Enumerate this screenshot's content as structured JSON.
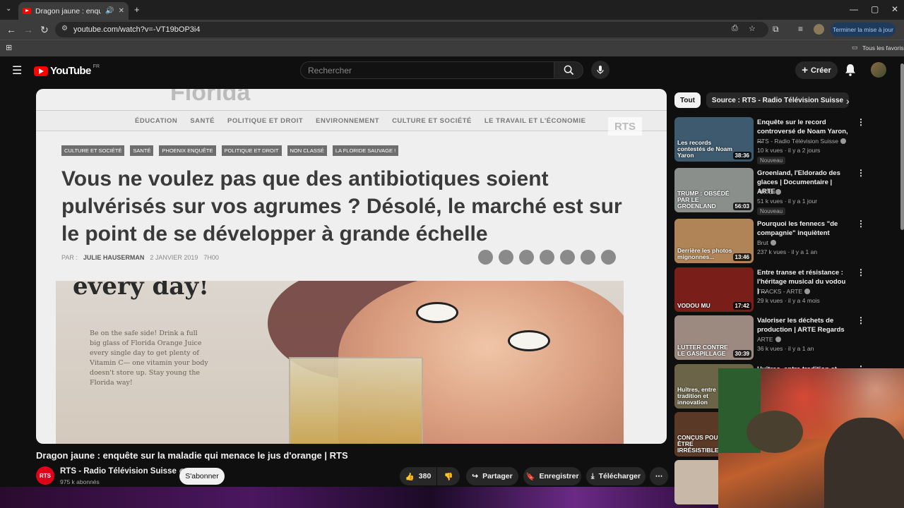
{
  "browser": {
    "tab_title": "Dragon jaune : enquête sur",
    "url": "youtube.com/watch?v=-VT19bOP3i4",
    "update_button": "Terminer la mise à jour",
    "bookmarks_all": "Tous les favoris"
  },
  "youtube": {
    "logo_text": "YouTube",
    "logo_region": "FR",
    "search_placeholder": "Rechercher",
    "create_label": "Créer"
  },
  "video": {
    "site_nav": [
      "ÉDUCATION",
      "SANTÉ",
      "POLITIQUE ET DROIT",
      "ENVIRONNEMENT",
      "CULTURE ET SOCIÉTÉ",
      "LE TRAVAIL ET L'ÉCONOMIE"
    ],
    "watermark": "RTS",
    "tags": [
      "CULTURE ET SOCIÉTÉ",
      "SANTÉ",
      "PHOENIX ENQUÊTE",
      "POLITIQUE ET DROIT",
      "NON CLASSÉ",
      "LA FLORIDE SAUVAGE !"
    ],
    "headline": "Vous ne voulez pas que des antibiotiques soient pulvérisés sur vos agrumes ? Désolé, le marché est sur le point de se développer à grande échelle",
    "byline_par": "PAR :",
    "byline_author": "JULIE HAUSERMAN",
    "byline_date": "2 JANVIER 2019",
    "byline_time": "7H00",
    "ad_headline": "every day!",
    "ad_text": "Be on the safe side! Drink a full big glass of Florida Orange Juice every single day to get plenty of Vitamin C— one vitamin your body doesn't store up. Stay young the Florida way!",
    "title": "Dragon jaune : enquête sur la maladie qui menace le jus d'orange | RTS"
  },
  "channel": {
    "logo_text": "RTS",
    "name": "RTS - Radio Télévision Suisse",
    "subscribers": "975 k abonnés",
    "subscribe_label": "S'abonner"
  },
  "actions": {
    "likes": "380",
    "share": "Partager",
    "save": "Enregistrer",
    "download": "Télécharger"
  },
  "sidebar": {
    "chips": [
      "Tout",
      "Source : RTS - Radio Télévision Suisse"
    ],
    "recommendations": [
      {
        "title": "Enquête sur le record controversé de Noam Yaron, ...",
        "channel": "RTS - Radio Télévision Suisse",
        "meta": "10 k vues · il y a 2 jours",
        "badge": "Nouveau",
        "duration": "38:36",
        "overlay": "Les records contestés de Noam Yaron",
        "thumb_color": "#3d5a6e"
      },
      {
        "title": "Groenland, l'Eldorado des glaces | Documentaire | ARTE",
        "channel": "ARTE",
        "meta": "51 k vues · il y a 1 jour",
        "badge": "Nouveau",
        "duration": "56:03",
        "overlay": "TRUMP : OBSÉDÉ PAR LE GROENLAND",
        "thumb_color": "#8a8f8c"
      },
      {
        "title": "Pourquoi les fennecs \"de compagnie\" inquiètent",
        "channel": "Brut",
        "meta": "237 k vues · il y a 1 an",
        "badge": "",
        "duration": "13:46",
        "overlay": "Derrière les photos mignonnes...",
        "thumb_color": "#b08456"
      },
      {
        "title": "Entre transe et résistance : l'héritage musical du vodou | ...",
        "channel": "TRACKS - ARTE",
        "meta": "29 k vues · il y a 4 mois",
        "badge": "",
        "duration": "17:42",
        "overlay": "VODOU MU",
        "thumb_color": "#7a1e1a"
      },
      {
        "title": "Valoriser les déchets de production | ARTE Regards",
        "channel": "ARTE",
        "meta": "36 k vues · il y a 1 an",
        "badge": "",
        "duration": "30:39",
        "overlay": "LUTTER CONTRE LE GASPILLAGE",
        "thumb_color": "#9c8a80"
      },
      {
        "title": "Huîtres, entre tradition et",
        "channel": "",
        "meta": "",
        "badge": "",
        "duration": "",
        "overlay": "Huîtres, entre tradition et innovation",
        "thumb_color": "#6b6448"
      },
      {
        "title": "",
        "channel": "",
        "meta": "",
        "badge": "",
        "duration": "",
        "overlay": "CONÇUS POUR ÊTRE IRRÉSISTIBLES",
        "thumb_color": "#5a3a26"
      },
      {
        "title": "",
        "channel": "",
        "meta": "",
        "badge": "",
        "duration": "",
        "overlay": "",
        "thumb_color": "#c8b8a8"
      }
    ]
  }
}
